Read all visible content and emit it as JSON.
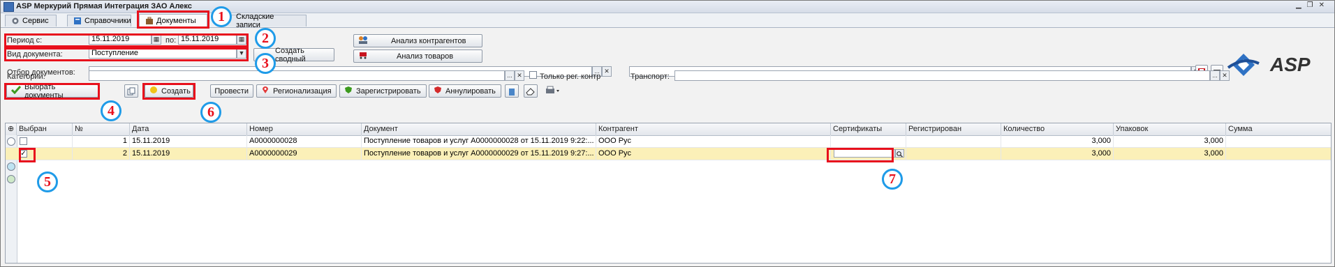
{
  "window": {
    "title": "ASP Меркурий Прямая Интеграция ЗАО Алекс"
  },
  "tabs": [
    {
      "label": "Сервис"
    },
    {
      "label": "Справочники"
    },
    {
      "label": "Документы"
    },
    {
      "label": "Складские записи"
    }
  ],
  "filters": {
    "period_from_label": "Период с:",
    "period_from": "15.11.2019",
    "period_to_label": "по:",
    "period_to": "15.11.2019",
    "doc_type_label": "Вид документа:",
    "doc_type": "Поступление",
    "selection_label": "Отбор документов:",
    "categories_label": "Категории:",
    "only_registered_label": "Только рег. контр",
    "transport_label": "Транспорт:"
  },
  "buttons": {
    "analysis_counterparties": "Анализ контрагентов",
    "create_summary": "Создать сводный",
    "analysis_goods": "Анализ товаров",
    "select_docs": "Выбрать документы",
    "create": "Создать",
    "conduct": "Провести",
    "regionalization": "Регионализация",
    "register": "Зарегистрировать",
    "cancel": "Аннулировать"
  },
  "logo_text": "ASP",
  "table": {
    "columns": [
      "Выбран",
      "№",
      "Дата",
      "Номер",
      "Документ",
      "Контрагент",
      "Сертификаты",
      "Регистрирован",
      "Количество",
      "Упаковок",
      "Сумма"
    ],
    "rows": [
      {
        "selected": "",
        "num": "1",
        "date": "15.11.2019",
        "number": "A0000000028",
        "document": "Поступление товаров и услуг A0000000028 от 15.11.2019 9:22:...",
        "counterparty": "ООО Рус",
        "certificates": "",
        "registered": "",
        "quantity": "3,000",
        "packages": "3,000",
        "sum": ""
      },
      {
        "selected": "✓",
        "num": "2",
        "date": "15.11.2019",
        "number": "A0000000029",
        "document": "Поступление товаров и услуг A0000000029 от 15.11.2019 9:27:...",
        "counterparty": "ООО Рус",
        "certificates": "",
        "registered": "",
        "quantity": "3,000",
        "packages": "3,000",
        "sum": ""
      }
    ]
  },
  "annotations": [
    "1",
    "2",
    "3",
    "4",
    "5",
    "6",
    "7"
  ],
  "colors": {
    "highlight_red": "#e8101c",
    "annotation_blue": "#1f9be8",
    "selected_row": "#fbf0b8"
  }
}
